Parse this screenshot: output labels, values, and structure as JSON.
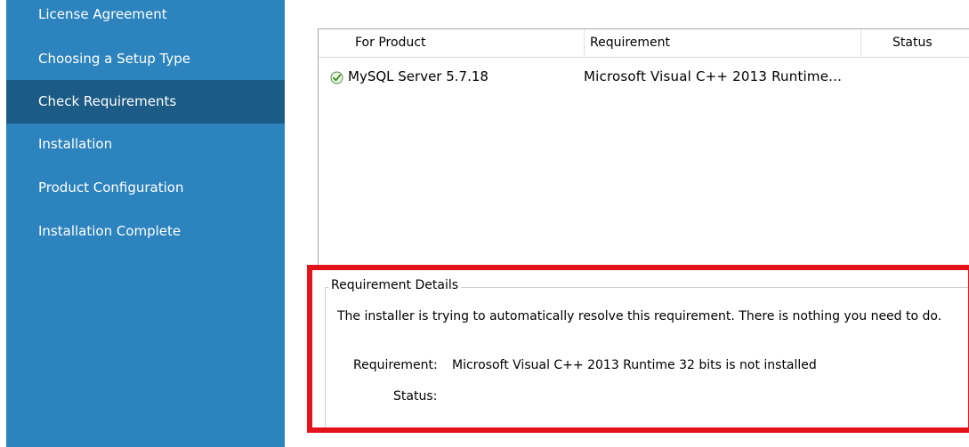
{
  "sidebar": {
    "steps": [
      {
        "label": "License Agreement"
      },
      {
        "label": "Choosing a Setup Type"
      },
      {
        "label": "Check Requirements"
      },
      {
        "label": "Installation"
      },
      {
        "label": "Product Configuration"
      },
      {
        "label": "Installation Complete"
      }
    ],
    "active_step": "Check Requirements",
    "bg_color": "#2c83bd",
    "active_color": "#1c5b85"
  },
  "requirements_list": {
    "columns": [
      "For Product",
      "Requirement",
      "Status"
    ],
    "rows": [
      {
        "icon": "check-icon",
        "product": "MySQL Server 5.7.18",
        "requirement": "Microsoft Visual C++ 2013 Runtime...",
        "status": ""
      }
    ]
  },
  "details": {
    "title": "Requirement Details",
    "message": "The installer is trying to automatically resolve this requirement.  There is nothing you need to do.",
    "requirement_label": "Requirement:",
    "requirement_value": "Microsoft Visual C++ 2013 Runtime 32 bits is not installed",
    "status_label": "Status:",
    "status_value": ""
  },
  "highlight_color": "#e3131b"
}
